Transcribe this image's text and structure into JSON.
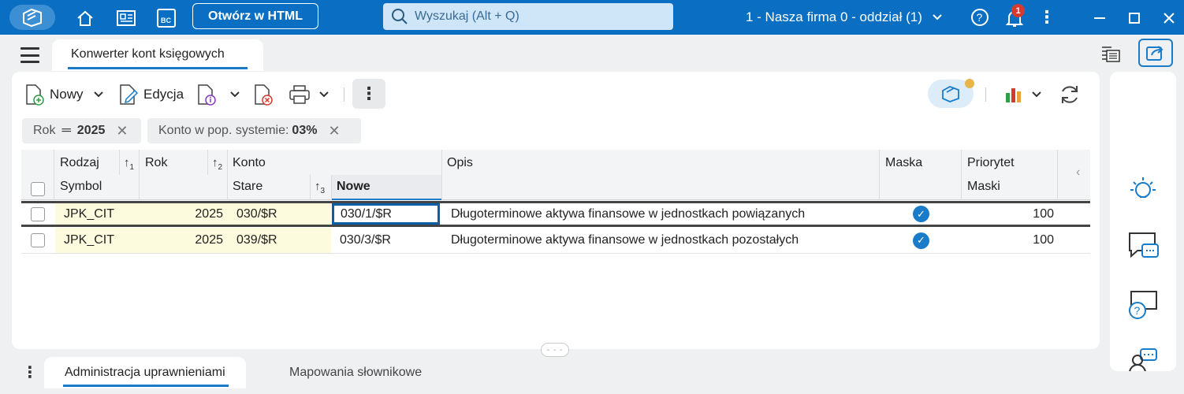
{
  "titlebar": {
    "open_html_label": "Otwórz w HTML",
    "search_placeholder": "Wyszukaj (Alt + Q)",
    "company": "1 - Nasza firma 0 - oddział (1)",
    "notifications_count": "1",
    "bc_label": "BC"
  },
  "page": {
    "tab_title": "Konwerter kont księgowych"
  },
  "toolbar": {
    "new_label": "Nowy",
    "edit_label": "Edycja",
    "more_label": "⋮"
  },
  "filters": [
    {
      "label": "Rok",
      "operator": "═",
      "value": "2025"
    },
    {
      "label": "Konto w pop. systemie:",
      "value": "03%"
    }
  ],
  "grid": {
    "headers": {
      "rodzaj": "Rodzaj",
      "symbol": "Symbol",
      "rok": "Rok",
      "konto": "Konto",
      "stare": "Stare",
      "nowe": "Nowe",
      "opis": "Opis",
      "maska": "Maska",
      "priorytet": "Priorytet",
      "maski": "Maski"
    },
    "sort": {
      "s1": "1",
      "s2": "2",
      "s3": "3"
    },
    "rows": [
      {
        "symbol": "JPK_CIT",
        "rok": "2025",
        "stare": "030/$R",
        "nowe": "030/1/$R",
        "opis": "Długoterminowe aktywa finansowe w jednostkach powiązanych",
        "maska": true,
        "priorytet": "100"
      },
      {
        "symbol": "JPK_CIT",
        "rok": "2025",
        "stare": "039/$R",
        "nowe": "030/3/$R",
        "opis": "Długoterminowe aktywa finansowe w jednostkach pozostałych",
        "maska": true,
        "priorytet": "100"
      }
    ]
  },
  "bottom_tabs": [
    {
      "label": "Administracja uprawnieniami",
      "active": true
    },
    {
      "label": "Mapowania słownikowe",
      "active": false
    }
  ],
  "colors": {
    "titlebar": "#0a6fc2",
    "accent": "#1a7cc9",
    "row_highlight": "#fdfbdd"
  },
  "icons": [
    "logo-icon",
    "home-icon",
    "document-icon",
    "bc-icon",
    "search-icon",
    "chevron-down-icon",
    "help-icon",
    "bell-icon",
    "kebab-icon",
    "minimize-icon",
    "maximize-icon",
    "close-icon",
    "list-icon",
    "share-icon",
    "new-doc-icon",
    "edit-icon",
    "info-doc-icon",
    "delete-doc-icon",
    "print-icon",
    "view-icon",
    "chart-icon",
    "refresh-icon",
    "lightbulb-icon",
    "chat-icon",
    "help-chat-icon",
    "support-icon"
  ]
}
